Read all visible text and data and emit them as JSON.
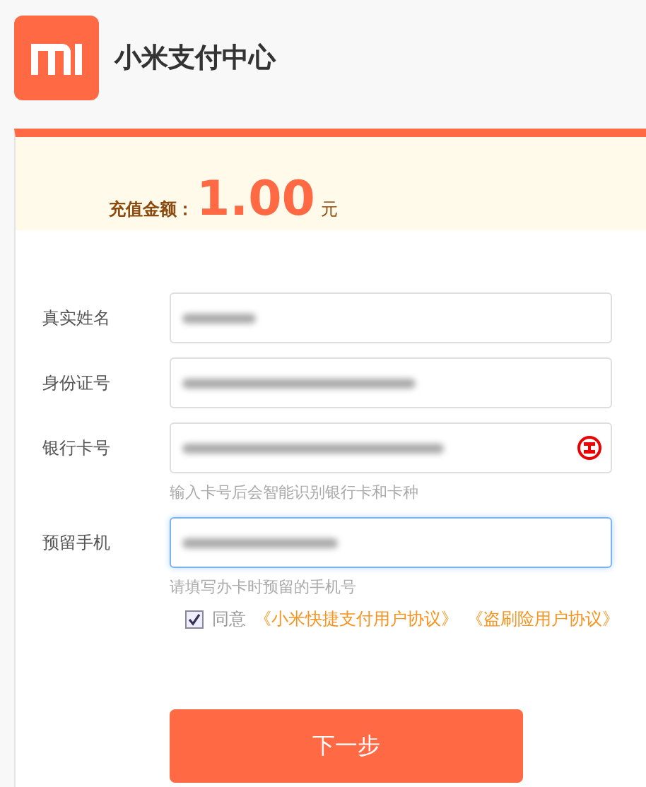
{
  "header": {
    "title": "小米支付中心"
  },
  "amount": {
    "label": "充值金额：",
    "value": "1.00",
    "unit": "元"
  },
  "fields": [
    {
      "label": "真实姓名",
      "kind": "plain",
      "focused": false
    },
    {
      "label": "身份证号",
      "kind": "plain",
      "focused": false
    },
    {
      "label": "银行卡号",
      "kind": "bank",
      "focused": false,
      "hint": "输入卡号后会智能识别银行卡和卡种"
    },
    {
      "label": "预留手机",
      "kind": "plain",
      "focused": true,
      "hint": "请填写办卡时预留的手机号"
    }
  ],
  "agreement": {
    "checked": true,
    "text": "同意",
    "links": [
      "《小米快捷支付用户协议》",
      "《盗刷险用户协议》"
    ]
  },
  "button": {
    "label": "下一步"
  }
}
